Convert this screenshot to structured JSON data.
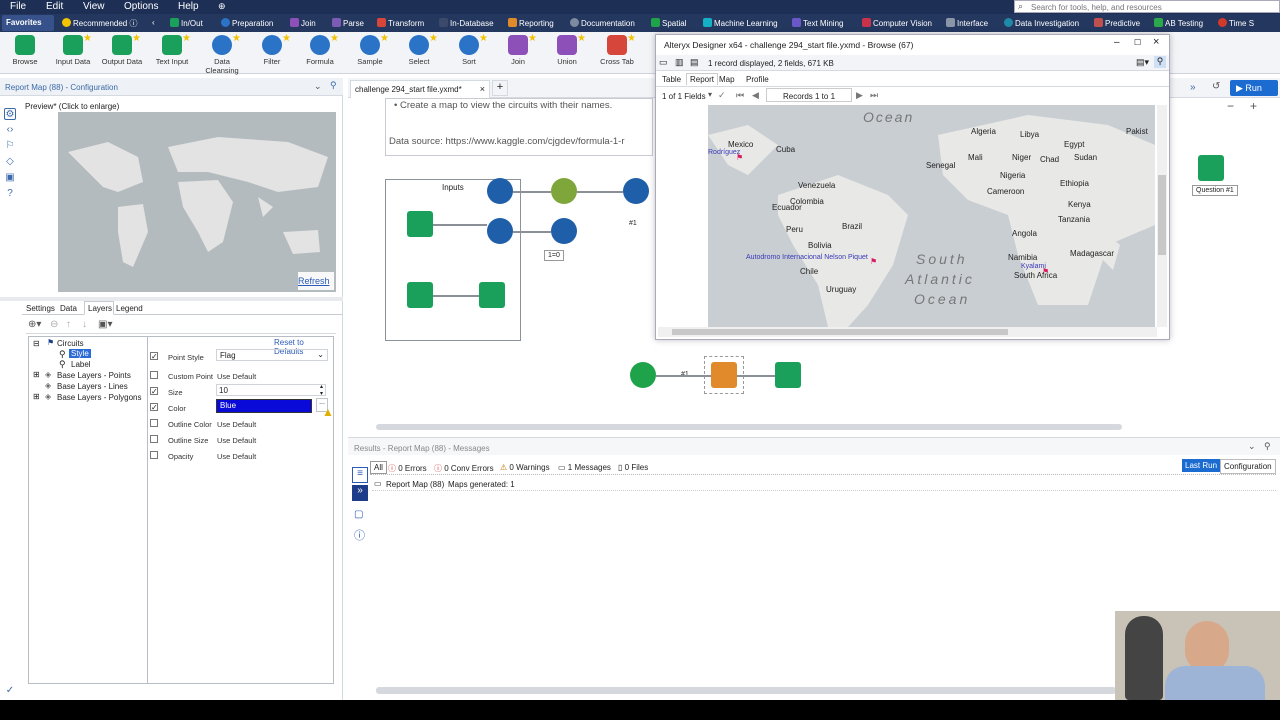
{
  "menu": [
    "File",
    "Edit",
    "View",
    "Options",
    "Help"
  ],
  "search_placeholder": "Search for tools, help, and resources",
  "categories": [
    {
      "label": "Favorites",
      "color": "#37528a"
    },
    {
      "label": "Recommended",
      "color": "#f2c300"
    },
    {
      "label": "In/Out",
      "color": "#1aa05b"
    },
    {
      "label": "Preparation",
      "color": "#2a73c7"
    },
    {
      "label": "Join",
      "color": "#8d4fb8"
    },
    {
      "label": "Parse",
      "color": "#7b5bb4"
    },
    {
      "label": "Transform",
      "color": "#d6463a"
    },
    {
      "label": "In-Database",
      "color": "#3b4a6b"
    },
    {
      "label": "Reporting",
      "color": "#e08a2b"
    },
    {
      "label": "Documentation",
      "color": "#7d8aa0"
    },
    {
      "label": "Spatial",
      "color": "#1fa34a"
    },
    {
      "label": "Machine Learning",
      "color": "#15b0c6"
    },
    {
      "label": "Text Mining",
      "color": "#6a58c8"
    },
    {
      "label": "Computer Vision",
      "color": "#c8324b"
    },
    {
      "label": "Interface",
      "color": "#8a95a8"
    },
    {
      "label": "Data Investigation",
      "color": "#1e8aa8"
    },
    {
      "label": "Predictive",
      "color": "#c0504d"
    },
    {
      "label": "AB Testing",
      "color": "#2aa84a"
    },
    {
      "label": "Time S",
      "color": "#d2392b"
    }
  ],
  "tools": [
    {
      "label": "Browse",
      "color": "#1aa05b"
    },
    {
      "label": "Input Data",
      "color": "#1aa05b"
    },
    {
      "label": "Output Data",
      "color": "#1aa05b"
    },
    {
      "label": "Text Input",
      "color": "#1aa05b"
    },
    {
      "label": "Data Cleansing",
      "color": "#2a73c7"
    },
    {
      "label": "Filter",
      "color": "#2a73c7"
    },
    {
      "label": "Formula",
      "color": "#2a73c7"
    },
    {
      "label": "Sample",
      "color": "#2a73c7"
    },
    {
      "label": "Select",
      "color": "#2a73c7"
    },
    {
      "label": "Sort",
      "color": "#2a73c7"
    },
    {
      "label": "Join",
      "color": "#8d4fb8"
    },
    {
      "label": "Union",
      "color": "#8d4fb8"
    },
    {
      "label": "Cross Tab",
      "color": "#d6463a"
    }
  ],
  "config": {
    "title": "Report Map (88) - Configuration",
    "preview": "Preview* (Click to enlarge)",
    "refresh": "Refresh",
    "tabs": [
      "Settings",
      "Data",
      "Layers",
      "Legend"
    ],
    "tree": [
      "Circuits",
      "Style",
      "Label",
      "Base Layers - Points",
      "Base Layers - Lines",
      "Base Layers - Polygons"
    ],
    "reset": "Reset to Defaults",
    "props": [
      {
        "label": "Point Style",
        "checked": true,
        "value": "Flag"
      },
      {
        "label": "Custom Point",
        "checked": false,
        "value": "Use Default"
      },
      {
        "label": "Size",
        "checked": true,
        "value": "10"
      },
      {
        "label": "Color",
        "checked": true,
        "value": "Blue"
      },
      {
        "label": "Outline Color",
        "checked": false,
        "value": "Use Default"
      },
      {
        "label": "Outline Size",
        "checked": false,
        "value": "Use Default"
      },
      {
        "label": "Opacity",
        "checked": false,
        "value": "Use Default"
      }
    ]
  },
  "canvas": {
    "tab": "challenge 294_start file.yxmd*",
    "text1": "• Create a map to view the circuits with their names.",
    "text2": "Data source: https://www.kaggle.com/cjgdev/formula-1-r",
    "inputs": "Inputs",
    "filter_badge": "1=0",
    "hash1": "#1",
    "hash2": "#1",
    "question": "Question #1",
    "run": "Run"
  },
  "browse": {
    "title": "Alteryx Designer x64 - challenge 294_start file.yxmd - Browse (67)",
    "summary": "1 record displayed, 2 fields, 671 KB",
    "tabs": [
      "Table",
      "Report",
      "Map",
      "Profile"
    ],
    "fields": "1 of 1 Fields",
    "records": "Records 1 to 1",
    "map_labels": {
      "ocean1": "Ocean",
      "ocean2": "South",
      "ocean3": "Atlantic",
      "ocean4": "Ocean",
      "countries": [
        "Algeria",
        "Libya",
        "Egypt",
        "Pakist",
        "Mexico",
        "Cuba",
        "Mali",
        "Niger",
        "Chad",
        "Sudan",
        "Senegal",
        "Nigeria",
        "Ethiopia",
        "Cameroon",
        "Kenya",
        "Venezuela",
        "Ecuador",
        "Tanzania",
        "Colombia",
        "Brazil",
        "Peru",
        "Bolivia",
        "Angola",
        "Chile",
        "Namibia",
        "Madagascar",
        "Uruguay",
        "South Africa"
      ],
      "circuits": [
        "Rodríguez",
        "Autodromo Internacional Nelson Piquet",
        "Kyalami"
      ]
    }
  },
  "results": {
    "title": "Results - Report Map (88) - Messages",
    "filters": [
      "All",
      "0 Errors",
      "0 Conv Errors",
      "0 Warnings",
      "1 Messages",
      "0 Files"
    ],
    "row": [
      "Report Map (88)",
      "Maps generated: 1"
    ],
    "last_run": "Last Run",
    "configuration": "Configuration"
  }
}
